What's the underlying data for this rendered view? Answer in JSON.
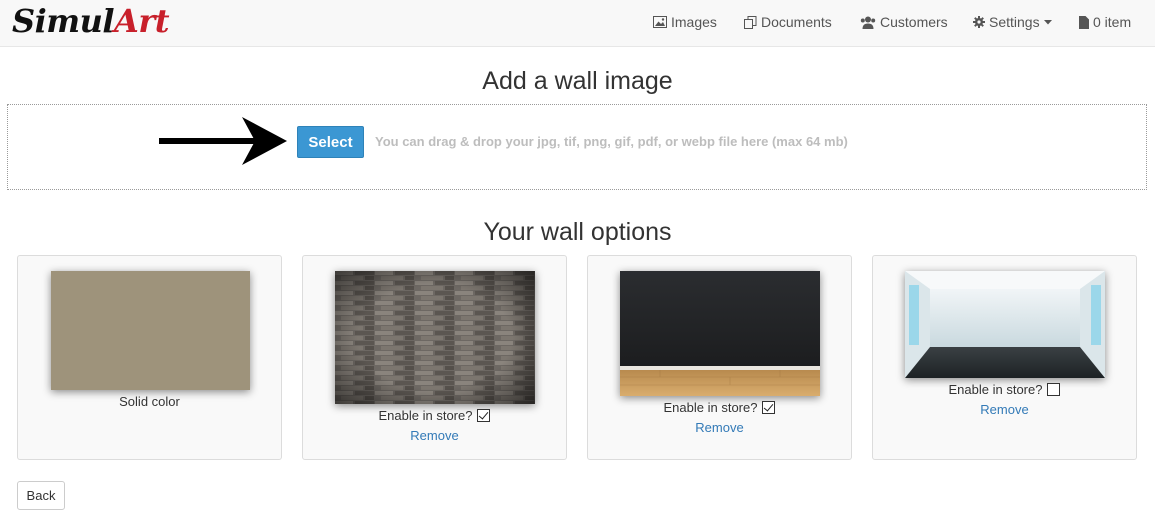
{
  "brand": {
    "part1": "Simul",
    "part2": "Art",
    "part2_color": "#c8202b"
  },
  "nav": {
    "images": "Images",
    "documents": "Documents",
    "customers": "Customers",
    "settings": "Settings",
    "cart": "0 item"
  },
  "upload": {
    "title": "Add a wall image",
    "select_label": "Select",
    "hint": "You can drag & drop your jpg, tif, png, gif, pdf, or webp file here (max 64 mb)",
    "accent": "#3b97d3"
  },
  "walls": {
    "title": "Your wall options",
    "items": [
      {
        "caption": "Solid color",
        "swatch": "#9e937b"
      },
      {
        "enable_label": "Enable in store?",
        "enabled": true,
        "remove_label": "Remove"
      },
      {
        "enable_label": "Enable in store?",
        "enabled": true,
        "remove_label": "Remove"
      },
      {
        "enable_label": "Enable in store?",
        "enabled": false,
        "remove_label": "Remove"
      }
    ]
  },
  "footer": {
    "back_label": "Back"
  }
}
